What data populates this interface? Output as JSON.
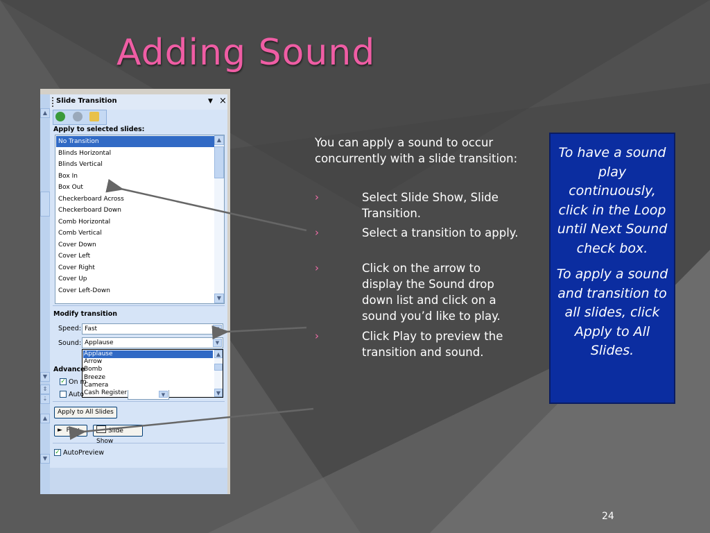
{
  "slide": {
    "title": "Adding Sound",
    "page_number": "24",
    "body_intro": "You can apply a sound to occur concurrently with a slide transition:",
    "bullet_marker": "›",
    "bullets": [
      "Select Slide Show, Slide Transition.",
      "Select a transition to apply.",
      "Click on the arrow to display the Sound drop down list and click on a sound you’d like to play.",
      "Click Play to preview the transition and sound."
    ],
    "callout": [
      "To have a sound play continuously, click in the Loop until Next Sound check box.",
      "To apply a sound and transition to all slides, click Apply to All Slides."
    ]
  },
  "pane": {
    "title": "Slide Transition",
    "apply_label": "Apply to selected slides:",
    "transitions": [
      "No Transition",
      "Blinds Horizontal",
      "Blinds Vertical",
      "Box In",
      "Box Out",
      "Checkerboard Across",
      "Checkerboard Down",
      "Comb Horizontal",
      "Comb Vertical",
      "Cover Down",
      "Cover Left",
      "Cover Right",
      "Cover Up",
      "Cover Left-Down"
    ],
    "selected_transition": "No Transition",
    "modify_label": "Modify transition",
    "speed_label": "Speed:",
    "speed_value": "Fast",
    "sound_label": "Sound:",
    "sound_value": "Applause",
    "sound_options": [
      "Applause",
      "Arrow",
      "Bomb",
      "Breeze",
      "Camera",
      "Cash Register"
    ],
    "advance_label": "Advance",
    "on_mouse_label": "On m",
    "auto_label": "Auto",
    "apply_all_button": "Apply to All Slides",
    "play_button": "Play",
    "slideshow_button": "Slide Show",
    "autopreview_label": "AutoPreview"
  },
  "colors": {
    "title": "#ef5da4",
    "callout_bg": "#0b2da0",
    "selection": "#316ac5"
  }
}
